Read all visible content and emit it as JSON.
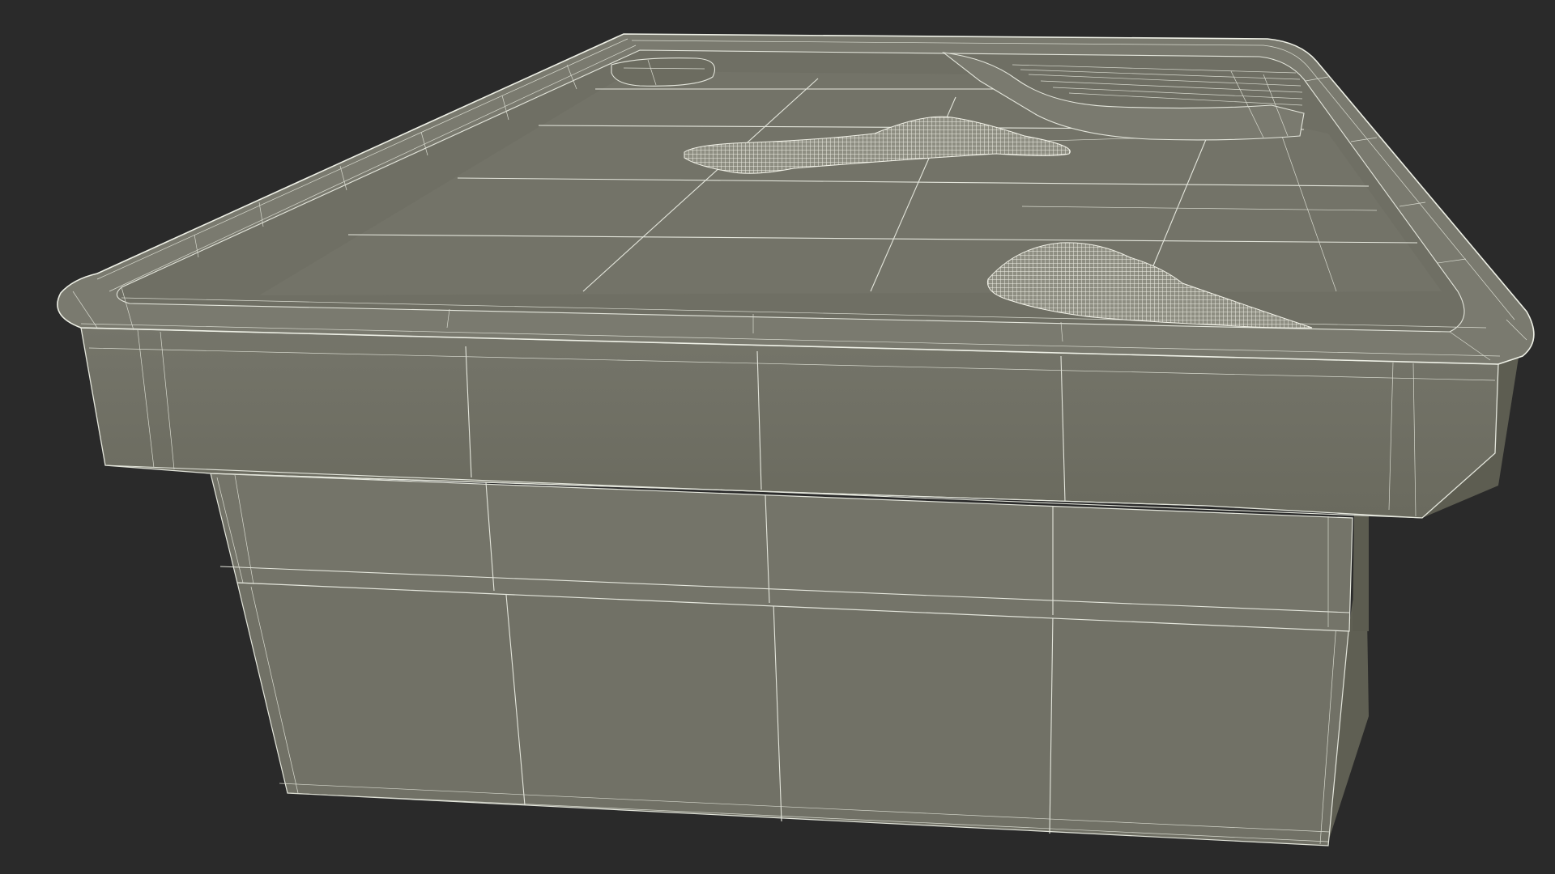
{
  "scene": {
    "colors": {
      "background": "#2a2a2a",
      "surface": "#737368",
      "surface_dark": "#676759",
      "surface_light": "#7b7b70",
      "wire": "#e4e6dc",
      "cloth": "#d6d6c8"
    }
  }
}
